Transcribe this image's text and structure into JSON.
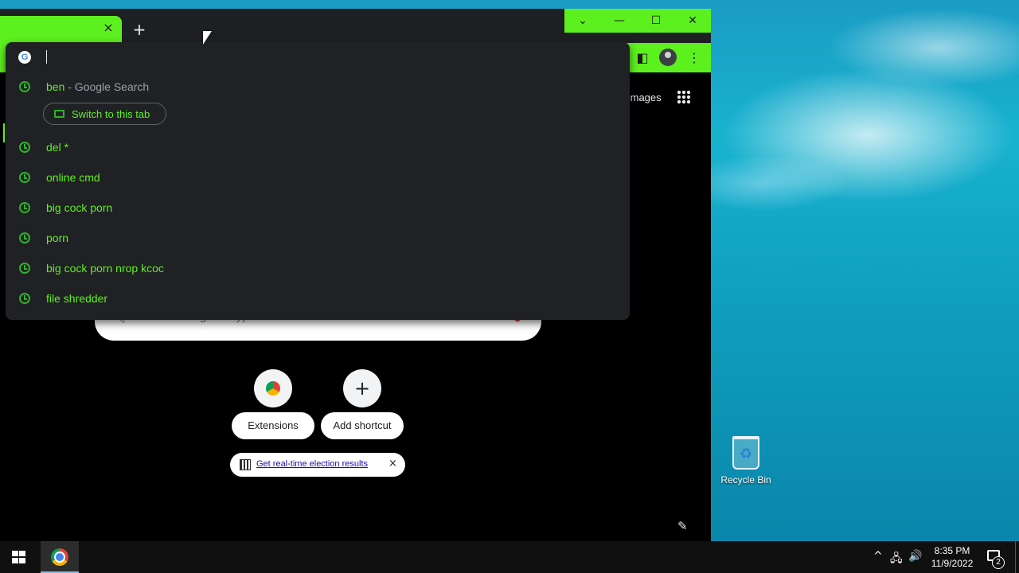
{
  "browser": {
    "tab_close_glyph": "×",
    "new_tab_glyph": "+",
    "window_controls": {
      "tab_search": "⌄",
      "minimize": "—",
      "maximize": "☐",
      "close": "✕"
    },
    "toolbar": {
      "side_panel": "◧",
      "menu": "⋮"
    },
    "accent_color": "#5df01f"
  },
  "omnibox": {
    "input_value": "",
    "suggestions": [
      {
        "text": "ben",
        "sub": " - Google Search"
      },
      {
        "text": "del *",
        "sub": ""
      },
      {
        "text": "online cmd",
        "sub": ""
      },
      {
        "text": "big cock porn",
        "sub": ""
      },
      {
        "text": "porn",
        "sub": ""
      },
      {
        "text": "big cock porn nrop kcoc",
        "sub": ""
      },
      {
        "text": "file shredder",
        "sub": ""
      }
    ],
    "switch_tab_label": "Switch to this tab"
  },
  "ntp": {
    "images_link": "Images",
    "search_placeholder": "Search Google or type a URL",
    "shortcuts": [
      {
        "label": "Extensions",
        "icon": "chrome-icon"
      },
      {
        "label": "Add shortcut",
        "icon": "plus-icon",
        "glyph": "+"
      }
    ],
    "promo_text": "Get real-time election results",
    "promo_close": "×",
    "customize_glyph": "✎"
  },
  "desktop": {
    "recycle_bin_label": "Recycle Bin"
  },
  "taskbar": {
    "time": "8:35 PM",
    "date": "11/9/2022",
    "notification_count": "2",
    "tray": {
      "chevron": "^",
      "network": "🖧",
      "volume": "🔊"
    }
  }
}
